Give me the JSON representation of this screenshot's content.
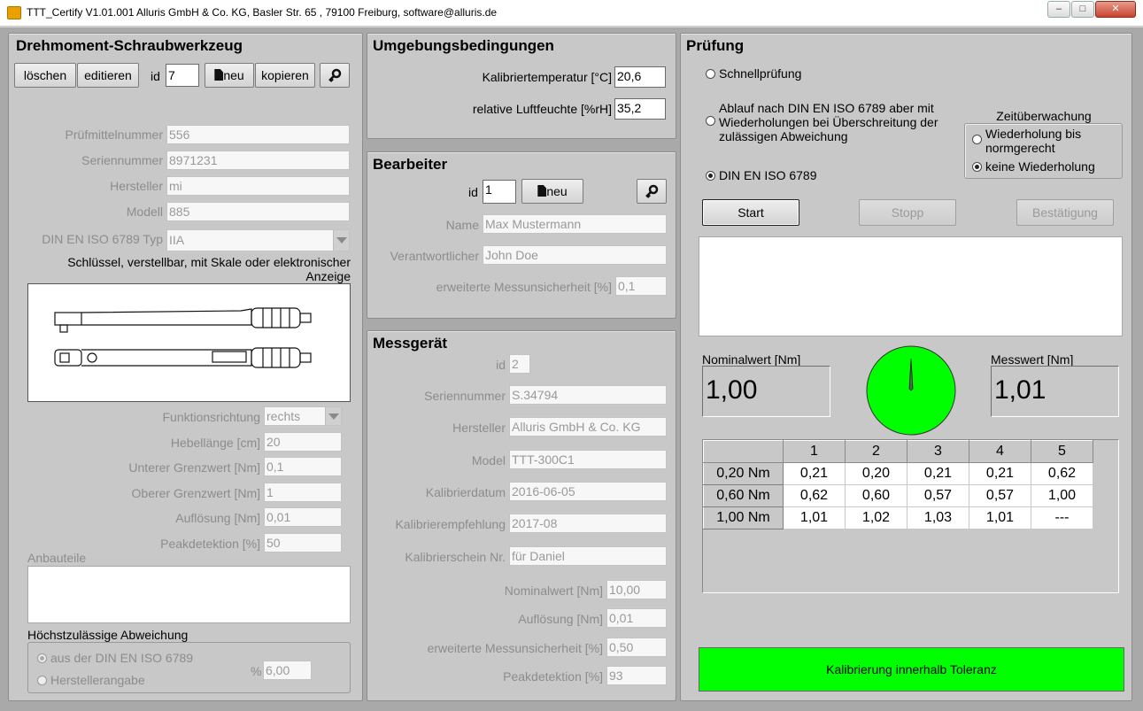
{
  "window": {
    "title": "TTT_Certify V1.01.001 Alluris GmbH & Co. KG, Basler Str. 65 , 79100 Freiburg, software@alluris.de",
    "minimize": "–",
    "maximize": "□",
    "close": "✕"
  },
  "tool": {
    "title": "Drehmoment-Schraubwerkzeug",
    "delete_label": "löschen",
    "edit_label": "editieren",
    "id_label": "id",
    "id_value": "7",
    "new_label": "neu",
    "copy_label": "kopieren",
    "fields": [
      {
        "label": "Prüfmittelnummer",
        "value": "556"
      },
      {
        "label": "Seriennummer",
        "value": "8971231"
      },
      {
        "label": "Hersteller",
        "value": "mi"
      },
      {
        "label": "Modell",
        "value": "885"
      }
    ],
    "type_label": "DIN EN ISO 6789 Typ",
    "type_value": "IIA",
    "type_description": "Schlüssel, verstellbar, mit Skale oder elektronischer Anzeige",
    "params": [
      {
        "label": "Funktionsrichtung",
        "value": "rechts"
      },
      {
        "label": "Hebellänge [cm]",
        "value": "20"
      },
      {
        "label": "Unterer Grenzwert [Nm]",
        "value": "0,1"
      },
      {
        "label": "Oberer Grenzwert [Nm]",
        "value": "1"
      },
      {
        "label": "Auflösung [Nm]",
        "value": "0,01"
      },
      {
        "label": "Peakdetektion [%]",
        "value": "50"
      }
    ],
    "attachments_label": "Anbauteile",
    "attachments_value": "",
    "deviation_label": "Höchstzulässige Abweichung",
    "deviation_opt1": "aus der DIN EN ISO 6789",
    "deviation_opt2": "Herstellerangabe",
    "deviation_unit": "%",
    "deviation_value": "6,00"
  },
  "env": {
    "title": "Umgebungsbedingungen",
    "temp_label": "Kalibriertemperatur [°C]",
    "temp_value": "20,6",
    "humidity_label": "relative Luftfeuchte [%rH]",
    "humidity_value": "35,2"
  },
  "operator": {
    "title": "Bearbeiter",
    "id_label": "id",
    "id_value": "1",
    "new_label": "neu",
    "name_label": "Name",
    "name_value": "Max Mustermann",
    "resp_label": "Verantwortlicher",
    "resp_value": "John Doe",
    "unc_label": "erweiterte Messunsicherheit [%]",
    "unc_value": "0,1"
  },
  "device": {
    "title": "Messgerät",
    "id_label": "id",
    "id_value": "2",
    "fields": [
      {
        "label": "Seriennummer",
        "value": "S.34794"
      },
      {
        "label": "Hersteller",
        "value": "Alluris GmbH & Co. KG"
      },
      {
        "label": "Model",
        "value": "TTT-300C1"
      },
      {
        "label": "Kalibrierdatum",
        "value": "2016-06-05"
      },
      {
        "label": "Kalibrierempfehlung",
        "value": "2017-08"
      },
      {
        "label": "Kalibrierschein Nr.",
        "value": "für Daniel"
      }
    ],
    "small_fields": [
      {
        "label": "Nominalwert [Nm]",
        "value": "10,00"
      },
      {
        "label": "Auflösung [Nm]",
        "value": "0,01"
      },
      {
        "label": "erweiterte Messunsicherheit [%]",
        "value": "0,50"
      },
      {
        "label": "Peakdetektion [%]",
        "value": "93"
      }
    ]
  },
  "test": {
    "title": "Prüfung",
    "quick": "Schnellprüfung",
    "mode_repeat": "Ablauf nach DIN EN ISO 6789 aber mit Wiederholungen bei Überschreitung der zulässigen Abweichung",
    "mode_din": "DIN EN ISO 6789",
    "time_title": "Zeitüberwachung",
    "time_opt1": "Wiederholung bis normgerecht",
    "time_opt2": "keine Wiederholung",
    "start": "Start",
    "stop": "Stopp",
    "confirm": "Bestätigung",
    "log": "",
    "nominal_label": "Nominalwert [Nm]",
    "nominal_value": "1,00",
    "measured_label": "Messwert [Nm]",
    "measured_value": "1,01",
    "gauge_level": 0.0,
    "columns": [
      "1",
      "2",
      "3",
      "4",
      "5"
    ],
    "rows": [
      {
        "label": "0,20 Nm",
        "values": [
          "0,21",
          "0,20",
          "0,21",
          "0,21",
          "0,62"
        ]
      },
      {
        "label": "0,60 Nm",
        "values": [
          "0,62",
          "0,60",
          "0,57",
          "0,57",
          "1,00"
        ]
      },
      {
        "label": "1,00 Nm",
        "values": [
          "1,01",
          "1,02",
          "1,03",
          "1,01",
          "---"
        ]
      }
    ],
    "status": "Kalibrierung innerhalb Toleranz",
    "colors": {
      "ok": "#00ff00",
      "panel": "#c8c8c8"
    }
  }
}
